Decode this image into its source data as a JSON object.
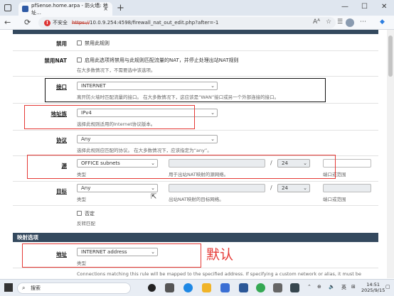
{
  "browser": {
    "tab_title": "pfSense.home.arpa - 防火墙: 地址…",
    "tab_close": "×",
    "new_tab": "+",
    "insecure_label": "不安全",
    "url_scheme": "https://",
    "url_rest": "10.0.9.254:4598/firewall_nat_out_edit.php?after=-1"
  },
  "rows": {
    "disable": {
      "label": "禁用",
      "checkbox_text": "禁用此规则"
    },
    "nonat": {
      "label": "禁用NAT",
      "checkbox_text": "启用此选项将禁用与此规则匹配流量的NAT，并停止处理出站NAT规则",
      "help": "在大多数情况下，不需要选中该选项。"
    },
    "interface": {
      "label": "接口",
      "value": "INTERNET",
      "help": "离开防火墙时匹配流量的接口。 在大多数情况下，这应该是“WAN”接口或另一个外部连接的接口。"
    },
    "family": {
      "label": "地址族",
      "value": "IPv4",
      "help": "选择此规则适用的Internet协议版本。"
    },
    "protocol": {
      "label": "协议",
      "value": "Any",
      "help": "选择此规则应匹配的协议。 在大多数情况下，应该指定为“any”。"
    },
    "source": {
      "label": "源",
      "value": "OFFICE subnets",
      "type_help": "类型",
      "net_help": "用于出站NAT映射的源网络。",
      "mask": "24",
      "port_help": "端口或范围",
      "slash": "/"
    },
    "destination": {
      "label": "目标",
      "value": "Any",
      "type_help": "类型",
      "net_help": "出站NAT映射的目标网络。",
      "mask": "24",
      "port_help": "端口或范围",
      "slash": "/"
    },
    "invert": {
      "checkbox_text": "否定",
      "help": "反转匹配"
    }
  },
  "mapping": {
    "section_title": "映射选项",
    "address": {
      "label": "地址",
      "value": "INTERNET address",
      "help": "类型"
    },
    "footer_text": "Connections matching this rule will be mapped to the specified address. If specifying a custom network or alias, it must be"
  },
  "annotation": "默认",
  "taskbar": {
    "search": "搜索",
    "ime": "英",
    "time": "14:51",
    "date": "2025/9/15"
  }
}
